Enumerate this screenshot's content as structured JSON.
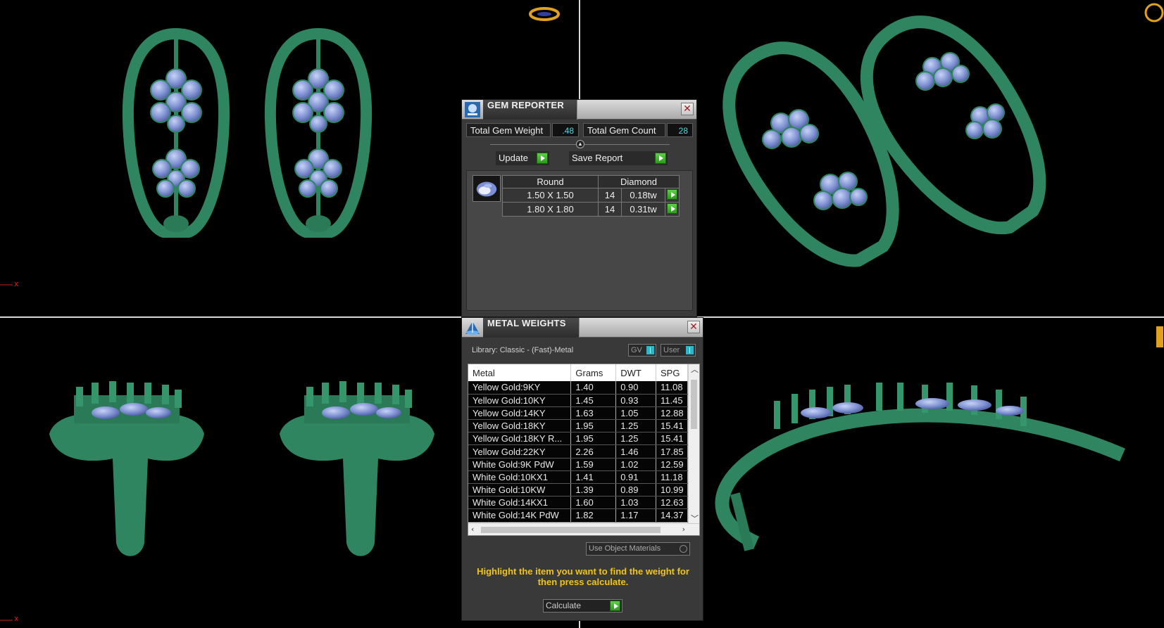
{
  "gem_reporter": {
    "title": "GEM REPORTER",
    "total_weight_label": "Total Gem Weight",
    "total_weight_value": ".48",
    "total_count_label": "Total Gem Count",
    "total_count_value": "28",
    "update_label": "Update",
    "save_report_label": "Save Report",
    "close_glyph": "✕",
    "header": {
      "shape": "Round",
      "material": "Diamond"
    },
    "rows": [
      {
        "size": "1.50 X 1.50",
        "count": "14",
        "weight": "0.18tw"
      },
      {
        "size": "1.80 X 1.80",
        "count": "14",
        "weight": "0.31tw"
      }
    ]
  },
  "metal_weights": {
    "title": "METAL WEIGHTS",
    "close_glyph": "✕",
    "library": "Library: Classic - (Fast)-Metal",
    "toggle_gv": "GV",
    "toggle_user": "User",
    "columns": [
      "Metal",
      "Grams",
      "DWT",
      "SPG"
    ],
    "rows": [
      {
        "metal": "Yellow Gold:9KY",
        "grams": "1.40",
        "dwt": "0.90",
        "spg": "11.08"
      },
      {
        "metal": "Yellow Gold:10KY",
        "grams": "1.45",
        "dwt": "0.93",
        "spg": "11.45"
      },
      {
        "metal": "Yellow Gold:14KY",
        "grams": "1.63",
        "dwt": "1.05",
        "spg": "12.88"
      },
      {
        "metal": "Yellow Gold:18KY",
        "grams": "1.95",
        "dwt": "1.25",
        "spg": "15.41"
      },
      {
        "metal": "Yellow Gold:18KY R...",
        "grams": "1.95",
        "dwt": "1.25",
        "spg": "15.41"
      },
      {
        "metal": "Yellow Gold:22KY",
        "grams": "2.26",
        "dwt": "1.46",
        "spg": "17.85"
      },
      {
        "metal": "White Gold:9K PdW",
        "grams": "1.59",
        "dwt": "1.02",
        "spg": "12.59"
      },
      {
        "metal": "White Gold:10KX1",
        "grams": "1.41",
        "dwt": "0.91",
        "spg": "11.18"
      },
      {
        "metal": "White Gold:10KW",
        "grams": "1.39",
        "dwt": "0.89",
        "spg": "10.99"
      },
      {
        "metal": "White Gold:14KX1",
        "grams": "1.60",
        "dwt": "1.03",
        "spg": "12.63"
      },
      {
        "metal": "White Gold:14K PdW",
        "grams": "1.82",
        "dwt": "1.17",
        "spg": "14.37"
      }
    ],
    "use_object_materials": "Use Object Materials",
    "hint": "Highlight the item you want to find the weight for then press calculate.",
    "calculate_label": "Calculate"
  },
  "viewports": {
    "axis_x": "x",
    "axis_y": "y"
  },
  "colors": {
    "metal_green": "#2e8560",
    "gem_blue": "#8a9fd8",
    "hint_yellow": "#f2c419",
    "value_cyan": "#4fd8e8"
  }
}
